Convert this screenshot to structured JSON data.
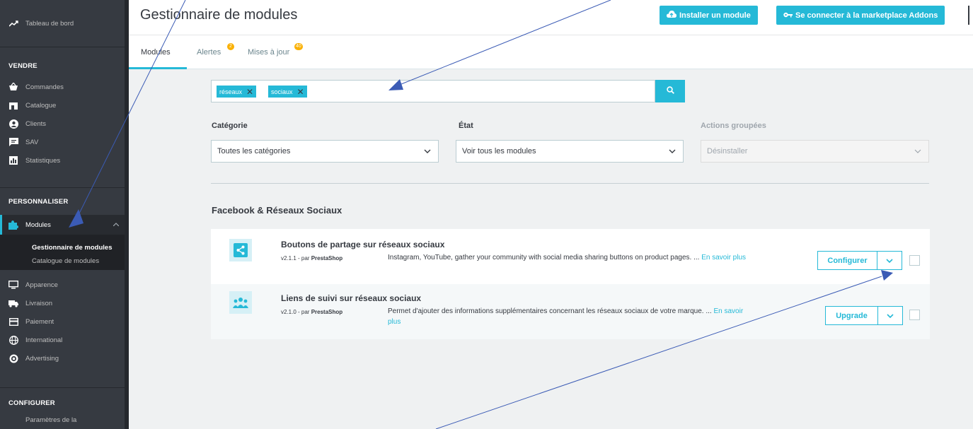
{
  "sidebar": {
    "dashboard": "Tableau de bord",
    "sections": {
      "sell": "VENDRE",
      "customize": "PERSONNALISER",
      "configure": "CONFIGURER"
    },
    "sell_items": [
      "Commandes",
      "Catalogue",
      "Clients",
      "SAV",
      "Statistiques"
    ],
    "modules_label": "Modules",
    "modules_sub": [
      "Gestionnaire de modules",
      "Catalogue de modules"
    ],
    "customize_items": [
      "Apparence",
      "Livraison",
      "Paiement",
      "International",
      "Advertising"
    ],
    "configure_items": [
      "Paramètres de la"
    ]
  },
  "header": {
    "title": "Gestionnaire de modules",
    "install_button": "Installer un module",
    "connect_button": "Se connecter à la marketplace Addons"
  },
  "tabs": [
    {
      "label": "Modules"
    },
    {
      "label": "Alertes",
      "badge": "2"
    },
    {
      "label": "Mises à jour",
      "badge": "40"
    }
  ],
  "search": {
    "tags": [
      "réseaux",
      "sociaux"
    ]
  },
  "filters": {
    "category_label": "Catégorie",
    "category_value": "Toutes les catégories",
    "state_label": "État",
    "state_value": "Voir tous les modules",
    "bulk_label": "Actions groupées",
    "bulk_value": "Désinstaller"
  },
  "category_title": "Facebook & Réseaux Sociaux",
  "modules": [
    {
      "name": "Boutons de partage sur réseaux sociaux",
      "version": "v2.1.1 - par ",
      "author": "PrestaShop",
      "description": "Instagram, YouTube, gather your community with social media sharing buttons on product pages. ...",
      "more": "En savoir plus",
      "action": "Configurer"
    },
    {
      "name": "Liens de suivi sur réseaux sociaux",
      "version": "v2.1.0 - par ",
      "author": "PrestaShop",
      "description": "Permet d'ajouter des informations supplémentaires concernant les réseaux sociaux de votre marque. ...",
      "more": "En savoir plus",
      "action": "Upgrade"
    }
  ],
  "colors": {
    "accent": "#25b9d7",
    "sidebar": "#363a41",
    "badge": "#fab000",
    "annotation_arrow": "#3b5bb5"
  }
}
